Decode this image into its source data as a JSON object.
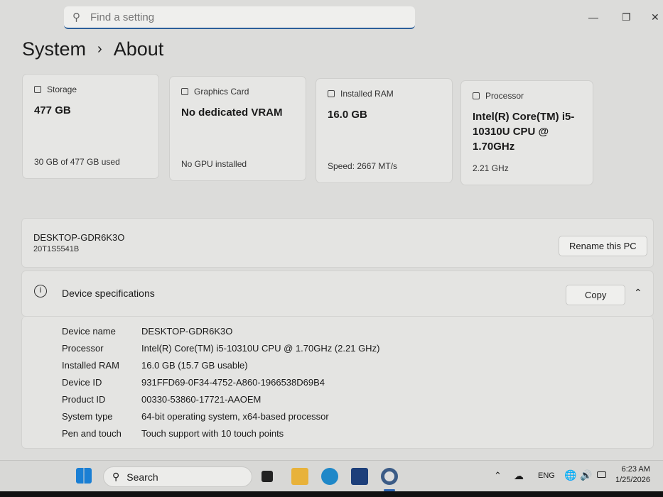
{
  "search": {
    "placeholder": "Find a setting"
  },
  "breadcrumb": {
    "parent": "System",
    "sep": "›",
    "current": "About"
  },
  "cards": [
    {
      "label": "Storage",
      "value": "477 GB",
      "sub": "30 GB of 477 GB used"
    },
    {
      "label": "Graphics Card",
      "value": "No dedicated VRAM",
      "sub": "No GPU installed"
    },
    {
      "label": "Installed RAM",
      "value": "16.0 GB",
      "sub": "Speed: 2667 MT/s"
    },
    {
      "label": "Processor",
      "value": "Intel(R) Core(TM) i5-10310U CPU @ 1.70GHz",
      "sub": "2.21 GHz"
    }
  ],
  "pc": {
    "name": "DESKTOP-GDR6K3O",
    "model": "20T1S5541B",
    "rename_label": "Rename this PC"
  },
  "device_specs": {
    "title": "Device specifications",
    "copy_label": "Copy",
    "rows": [
      {
        "k": "Device name",
        "v": "DESKTOP-GDR6K3O"
      },
      {
        "k": "Processor",
        "v": "Intel(R) Core(TM) i5-10310U CPU @ 1.70GHz (2.21 GHz)"
      },
      {
        "k": "Installed RAM",
        "v": "16.0 GB (15.7 GB usable)"
      },
      {
        "k": "Device ID",
        "v": "931FFD69-0F34-4752-A860-1966538D69B4"
      },
      {
        "k": "Product ID",
        "v": "00330-53860-17721-AAOEM"
      },
      {
        "k": "System type",
        "v": "64-bit operating system, x64-based processor"
      },
      {
        "k": "Pen and touch",
        "v": "Touch support with 10 touch points"
      }
    ]
  },
  "taskbar": {
    "search": "Search",
    "lang": "ENG",
    "time": "6:23 AM",
    "date": "1/25/2026"
  }
}
